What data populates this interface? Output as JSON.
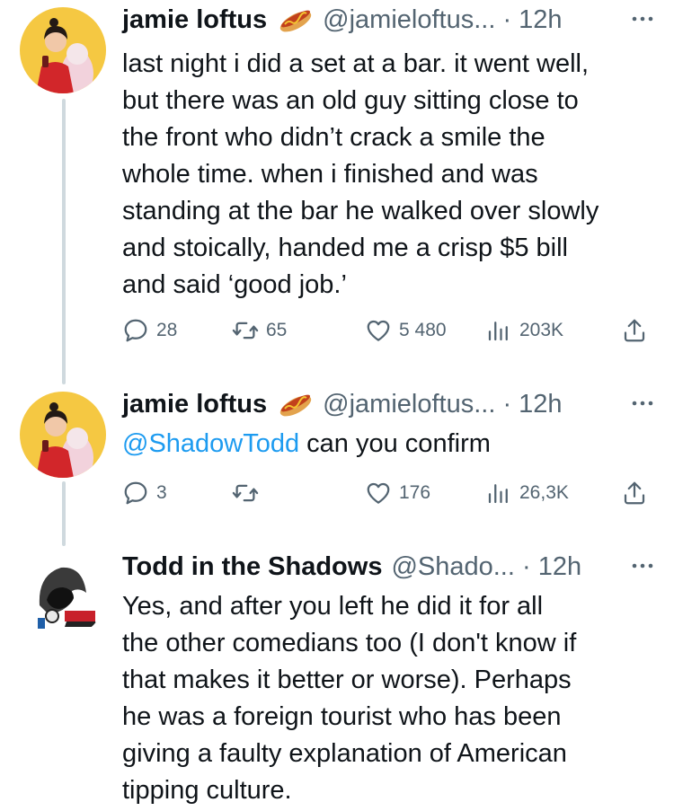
{
  "colors": {
    "text": "#0f1419",
    "secondary": "#536471",
    "link": "#1d9bf0",
    "thread_line": "#cfd9de"
  },
  "tweets": [
    {
      "name": "jamie loftus",
      "emoji": "hotdog-emoji",
      "handle": "@jamieloftus... · 12h",
      "lines": [
        "last night i did a set at a bar. it went well,",
        "but there was an old guy sitting close to",
        "the front who didn’t crack a smile the",
        "whole time. when i finished and was",
        "standing at the bar he walked over slowly",
        "and stoically, handed me a crisp $5 bill",
        "and said ‘good job.’"
      ],
      "replies": "28",
      "retweets": "65",
      "likes": "5 480",
      "views": "203K"
    },
    {
      "name": "jamie loftus",
      "emoji": "hotdog-emoji",
      "handle": "@jamieloftus... · 12h",
      "mention": "@ShadowTodd",
      "rest": " can you confirm",
      "replies": "3",
      "retweets": "",
      "likes": "176",
      "views": "26,3K"
    },
    {
      "name": "Todd in the Shadows",
      "handle": "@Shado... · 12h",
      "lines": [
        "Yes, and after you left he did it for all",
        "the other comedians too (I don't know if",
        "that makes it better or worse). Perhaps",
        "he was a foreign tourist who has been",
        "giving a faulty explanation of American",
        "tipping culture."
      ]
    }
  ]
}
